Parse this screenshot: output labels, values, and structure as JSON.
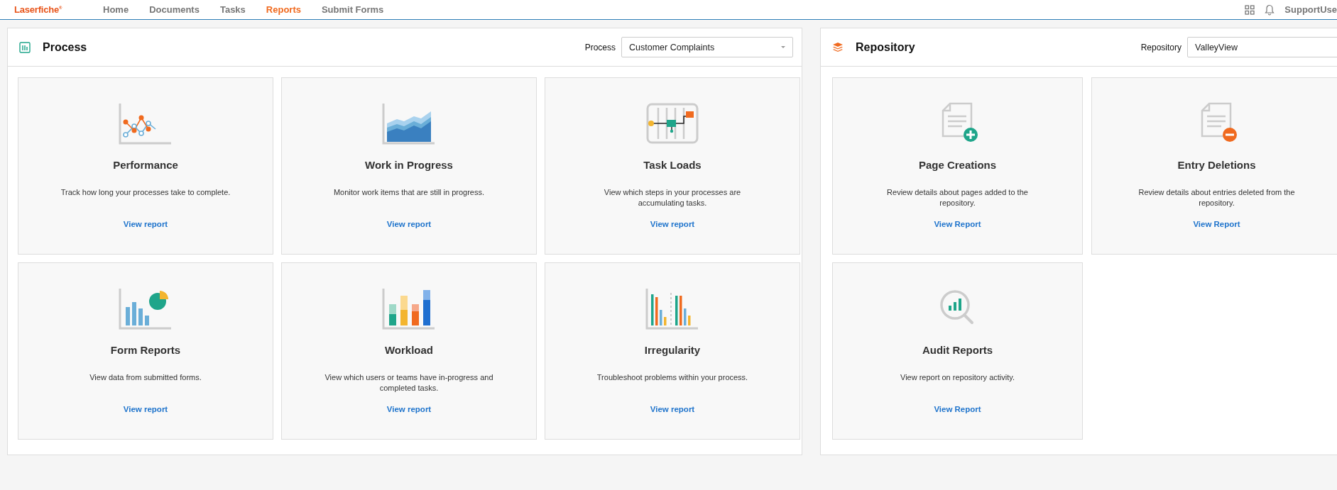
{
  "topbar": {
    "logo": "Laserfiche$^{®}$",
    "nav": [
      {
        "label": "Home",
        "selected": false
      },
      {
        "label": "Documents",
        "selected": false
      },
      {
        "label": "Tasks",
        "selected": false
      },
      {
        "label": "Reports",
        "selected": true
      },
      {
        "label": "Submit Forms",
        "selected": false
      }
    ],
    "user": "SupportUse"
  },
  "panels": [
    {
      "kind": "process",
      "title": "Process",
      "select_label": "Process",
      "select_value": "Customer Complaints",
      "cards": [
        {
          "kind": "performance",
          "title": "Performance",
          "description": "Track how long your processes take to complete.",
          "link": "View report"
        },
        {
          "kind": "wip",
          "title": "Work in Progress",
          "description": "Monitor work items that are still in progress.",
          "link": "View report"
        },
        {
          "kind": "taskloads",
          "title": "Task Loads",
          "description": "View which steps in your processes are accumulating tasks.",
          "link": "View report"
        },
        {
          "kind": "forms",
          "title": "Form Reports",
          "description": "View data from submitted forms.",
          "link": "View report"
        },
        {
          "kind": "workload",
          "title": "Workload",
          "description": "View which users or teams have in-progress and completed tasks.",
          "link": "View report"
        },
        {
          "kind": "irregularity",
          "title": "Irregularity",
          "description": "Troubleshoot problems within your process.",
          "link": "View report"
        }
      ]
    },
    {
      "kind": "repository",
      "title": "Repository",
      "select_label": "Repository",
      "select_value": "ValleyView",
      "cards": [
        {
          "kind": "page-add",
          "title": "Page Creations",
          "description": "Review details about pages added to the repository.",
          "link": "View Report"
        },
        {
          "kind": "entry-delete",
          "title": "Entry Deletions",
          "description": "Review details about entries deleted from the repository.",
          "link": "View Report"
        },
        {
          "kind": "audit",
          "title": "Audit Reports",
          "description": "View report on repository activity.",
          "link": "View Report"
        }
      ]
    }
  ]
}
